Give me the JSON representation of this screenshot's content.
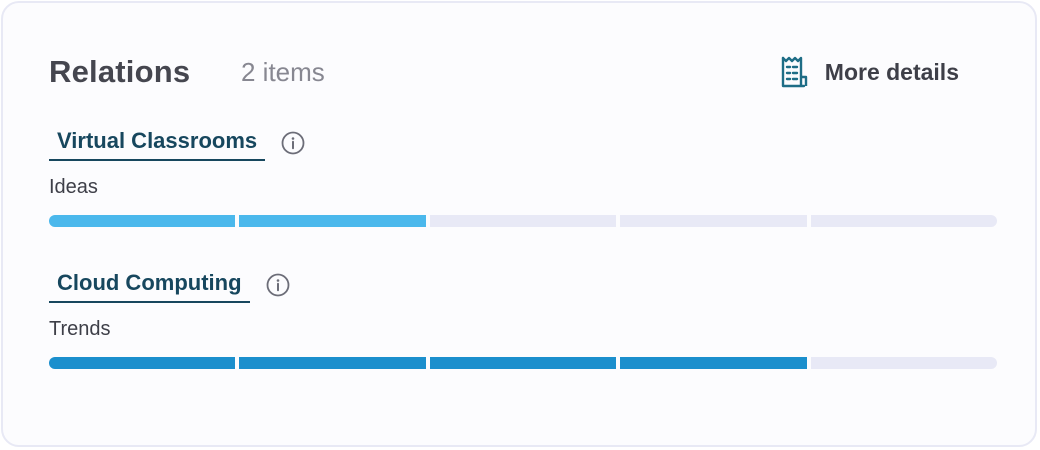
{
  "header": {
    "title": "Relations",
    "count": "2 items",
    "more_label": "More details",
    "more_icon": "report-document-icon"
  },
  "relations": [
    {
      "name": "Virtual Classrooms",
      "category": "Ideas",
      "info_icon": "info-icon",
      "level_filled": 2,
      "level_total": 5,
      "fill_color": "#4bb8ec"
    },
    {
      "name": "Cloud Computing",
      "category": "Trends",
      "info_icon": "info-icon",
      "level_filled": 4,
      "level_total": 5,
      "fill_color": "#1b8fcd"
    }
  ],
  "colors": {
    "empty_segment": "#e8e9f6",
    "link": "#17475e",
    "icon_accent": "#1e6d86"
  }
}
